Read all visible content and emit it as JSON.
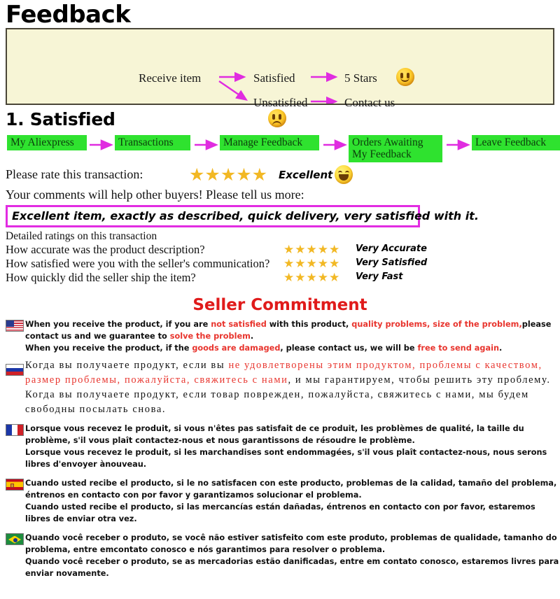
{
  "page": {
    "title": "Feedback"
  },
  "flow": {
    "receive": "Receive item",
    "satisfied": "Satisfied",
    "five_stars": "5 Stars",
    "unsatisfied": "Unsatisfied",
    "contact_us": "Contact us",
    "happy_face_icon": "happy-face-icon",
    "sad_face_icon": "sad-face-icon",
    "arrow_color": "#e02ce0",
    "box_bg": "#f7f5d6",
    "box_border": "#4a4637"
  },
  "section1": {
    "heading": "1. Satisfied",
    "step_color": "#2fe22f",
    "steps": [
      {
        "label": "My Aliexpress"
      },
      {
        "label": "Transactions"
      },
      {
        "label": "Manage Feedback"
      },
      {
        "label": "Orders Awaiting\nMy Feedback"
      },
      {
        "label": "Leave Feedback"
      }
    ],
    "rate_prompt": "Please rate this transaction:",
    "rate_stars": "★★★★★",
    "rate_word": "Excellent",
    "grin_face_icon": "grinning-face-icon",
    "comments_prompt": "Your comments will help other buyers! Please tell us more:",
    "comment_value": "Excellent item, exactly as described, quick delivery, very satisfied with it.",
    "comment_border_color": "#e22ce2",
    "detailed_title": "Detailed ratings on this transaction",
    "detailed_rows": [
      {
        "question": "How accurate was the product description?",
        "stars": "★★★★★",
        "label": "Very Accurate"
      },
      {
        "question": "How satisfied were you with the seller's communication?",
        "stars": "★★★★★",
        "label": "Very Satisfied"
      },
      {
        "question": "How quickly did the seller ship the item?",
        "stars": "★★★★★",
        "label": "Very Fast"
      }
    ]
  },
  "commitment": {
    "title": "Seller Commitment",
    "title_color": "#e01b1b",
    "highlight_color": "#e8352e",
    "languages": [
      {
        "flag": "us-flag-icon",
        "p1_a": "When you receive the product, if you are ",
        "p1_hl1": "not satisfied",
        "p1_b": " with this product, ",
        "p1_hl2": "quality problems, size of the problem,",
        "p1_c": "please contact us and we guarantee to ",
        "p1_hl3": "solve the problem",
        "p1_d": ".",
        "p2_a": "When you receive the product, if the ",
        "p2_hl1": "goods are damaged",
        "p2_b": ", please contact us, we will be ",
        "p2_hl2": "free to send again",
        "p2_c": "."
      },
      {
        "flag": "ru-flag-icon",
        "p1_a": "Когда вы получаете продукт, если вы ",
        "p1_hl1": "не удовлетворены этим продуктом, проблемы с качеством, размер проблемы, пожалуйста, свяжитесь с нами",
        "p1_b": ", и мы гарантируем, чтобы решить эту проблему.",
        "p2_a": "Когда вы получаете продукт, если товар поврежден, пожалуйста, свяжитесь с нами, мы будем свободны посылать снова."
      },
      {
        "flag": "fr-flag-icon",
        "p1_a": "Lorsque vous recevez le produit, si vous n'êtes pas satisfait de ce produit, les problèmes de qualité, la taille du problème, s'il vous plaît contactez-nous et nous garantissons de résoudre le problème.",
        "p2_a": "Lorsque vous recevez le produit, si les marchandises sont endommagées, s'il vous plaît contactez-nous, nous serons libres d'envoyer ànouveau."
      },
      {
        "flag": "es-flag-icon",
        "p1_a": "Cuando usted recibe el producto, si le no satisfacen con este producto, problemas de la calidad, tamaño del problema, éntrenos en contacto con por favor y garantizamos solucionar el problema.",
        "p2_a": "Cuando usted recibe el producto, si las mercancías están dañadas, éntrenos en contacto con por favor, estaremos libres de enviar otra vez."
      },
      {
        "flag": "br-flag-icon",
        "p1_a": "Quando você receber o produto, se você não estiver satisfeito com este produto, problemas de qualidade, tamanho do problema, entre emcontato conosco e nós garantimos para resolver o problema.",
        "p2_a": "Quando você receber o produto, se as mercadorias estão danificadas, entre em contato conosco, estaremos livres para enviar novamente."
      }
    ]
  }
}
